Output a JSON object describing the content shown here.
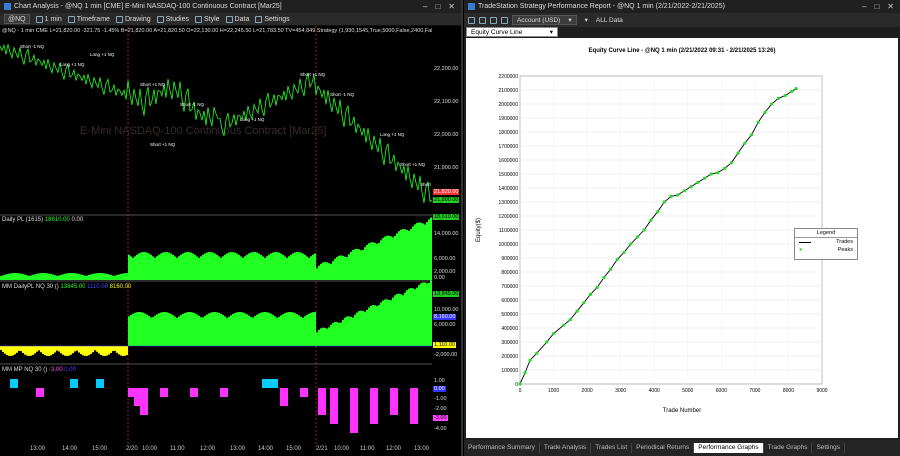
{
  "left_window": {
    "title": "Chart Analysis - @NQ 1 min [CME] E-Mini NASDAQ-100 Continuous Contract [Mar25]",
    "toolbar": {
      "symbol": "@NQ",
      "interval": "1 min",
      "timeframe": "Timeframe",
      "drawing": "Drawing",
      "studies": "Studies",
      "style": "Style",
      "data": "Data",
      "settings": "Settings"
    },
    "status_line": "@NQ - 1 min  CME  L=21,820.00  -321.75  -1.45%  B=21,820.00  A=21,820.50  O=22,130.00  H=22,245.50  L=21,783.50  TV=454,849  Strategy (1,930,1545,True,5000,False,2400,Fals...",
    "watermark": "E-Mini NASDAQ-100 Continuous Contract [Mar25]",
    "price_pane": {
      "ticks": [
        "22,200.00",
        "22,100.00",
        "22,000.00",
        "21,900.00"
      ],
      "last_tag": "21,820.00",
      "tag_low": "21,800.00",
      "markers": [
        "Short -1 NQ",
        "Long +1 NQ",
        "Short +1 NQ",
        "Short -1 NQ",
        "Long +1 NQ",
        "Short +1 NQ"
      ]
    },
    "daily_pl_pane": {
      "label": "Daily PL (1615)",
      "value": "18610.00",
      "value2": "0.00",
      "ticks": [
        "14,000.00",
        "6,000.00",
        "2,000.00",
        "0.00"
      ],
      "tag": "18,610.00"
    },
    "mm_dailypl_pane": {
      "label": "MM DailyPL NQ 30 ()",
      "v1": "13845.00",
      "v2": "1110.00",
      "v3": "8160.00",
      "ticks": [
        "10,000.00",
        "6,000.00",
        "-2,000.00"
      ],
      "tags": [
        "13,845.00",
        "8,160.00",
        "1,110.00"
      ]
    },
    "mm_mp_pane": {
      "label": "MM MP NQ 30 ()",
      "v1": "-3.00",
      "v2": "0.00",
      "ticks": [
        "1.00",
        "-1.00",
        "-2.00",
        "-3.00",
        "-4.00"
      ],
      "tags": [
        "0.00",
        "-3.00"
      ]
    },
    "time_ticks": [
      "13:00",
      "14:00",
      "15:00",
      "2/20",
      "10:00",
      "11:00",
      "12:00",
      "13:00",
      "14:00",
      "15:00",
      "2/21",
      "10:00",
      "11:00",
      "12:00",
      "13:00"
    ]
  },
  "right_window": {
    "title": "TradeStation Strategy Performance Report - @NQ 1 min (2/21/2022-2/21/2025)",
    "account_dropdown": "Account (USD)",
    "data_dropdown": "ALL Data",
    "graph_dropdown": "Equity Curve Line",
    "tabs": [
      "Performance Summary",
      "Trade Analysis",
      "Trades List",
      "Periodical Returns",
      "Performance Graphs",
      "Trade Graphs",
      "Settings"
    ],
    "active_tab": "Performance Graphs"
  },
  "chart_data": {
    "type": "line",
    "title": "Equity Curve Line - @NQ 1 min (2/21/2022 09:31 - 2/21/2025 13:26)",
    "xlabel": "Trade Number",
    "ylabel": "Equity($)",
    "xlim": [
      0,
      9000
    ],
    "ylim": [
      0,
      2200000
    ],
    "x_ticks": [
      0,
      1000,
      2000,
      3000,
      4000,
      5000,
      6000,
      7000,
      8000,
      9000
    ],
    "y_ticks": [
      0,
      100000,
      200000,
      300000,
      400000,
      500000,
      600000,
      700000,
      800000,
      900000,
      1000000,
      1100000,
      1200000,
      1300000,
      1400000,
      1500000,
      1600000,
      1700000,
      1800000,
      1900000,
      2000000,
      2100000,
      2200000
    ],
    "legend": {
      "title": "Legend",
      "entries": [
        "Trades",
        "Peaks"
      ],
      "position": "right"
    },
    "series": [
      {
        "name": "Trades",
        "color": "#000000",
        "x": [
          0,
          150,
          300,
          500,
          800,
          1000,
          1300,
          1500,
          1700,
          1900,
          2100,
          2300,
          2500,
          2700,
          2900,
          3100,
          3300,
          3500,
          3700,
          3900,
          4100,
          4300,
          4500,
          4700,
          4900,
          5100,
          5300,
          5500,
          5700,
          5900,
          6100,
          6300,
          6500,
          6700,
          6900,
          7100,
          7300,
          7500,
          7700,
          7900,
          8100,
          8230
        ],
        "y": [
          0,
          80000,
          170000,
          220000,
          300000,
          360000,
          420000,
          460000,
          520000,
          580000,
          640000,
          690000,
          760000,
          820000,
          890000,
          940000,
          1000000,
          1050000,
          1100000,
          1170000,
          1230000,
          1300000,
          1340000,
          1350000,
          1380000,
          1410000,
          1440000,
          1470000,
          1500000,
          1510000,
          1540000,
          1580000,
          1650000,
          1720000,
          1780000,
          1870000,
          1940000,
          2000000,
          2040000,
          2060000,
          2090000,
          2110000
        ]
      },
      {
        "name": "Peaks",
        "color": "#22dd22",
        "x": [
          0,
          150,
          300,
          500,
          800,
          1000,
          1300,
          1500,
          1700,
          1900,
          2100,
          2300,
          2500,
          2700,
          2900,
          3100,
          3300,
          3500,
          3700,
          3900,
          4100,
          4300,
          4500,
          4700,
          4900,
          5100,
          5300,
          5500,
          5700,
          5900,
          6100,
          6300,
          6500,
          6700,
          6900,
          7100,
          7300,
          7500,
          7700,
          7900,
          8100,
          8230
        ],
        "y": [
          0,
          80000,
          170000,
          220000,
          300000,
          360000,
          420000,
          460000,
          520000,
          580000,
          640000,
          690000,
          760000,
          820000,
          890000,
          940000,
          1000000,
          1050000,
          1100000,
          1170000,
          1230000,
          1300000,
          1340000,
          1350000,
          1380000,
          1410000,
          1440000,
          1470000,
          1500000,
          1510000,
          1540000,
          1580000,
          1650000,
          1720000,
          1780000,
          1870000,
          1940000,
          2000000,
          2040000,
          2060000,
          2090000,
          2110000
        ]
      }
    ]
  }
}
